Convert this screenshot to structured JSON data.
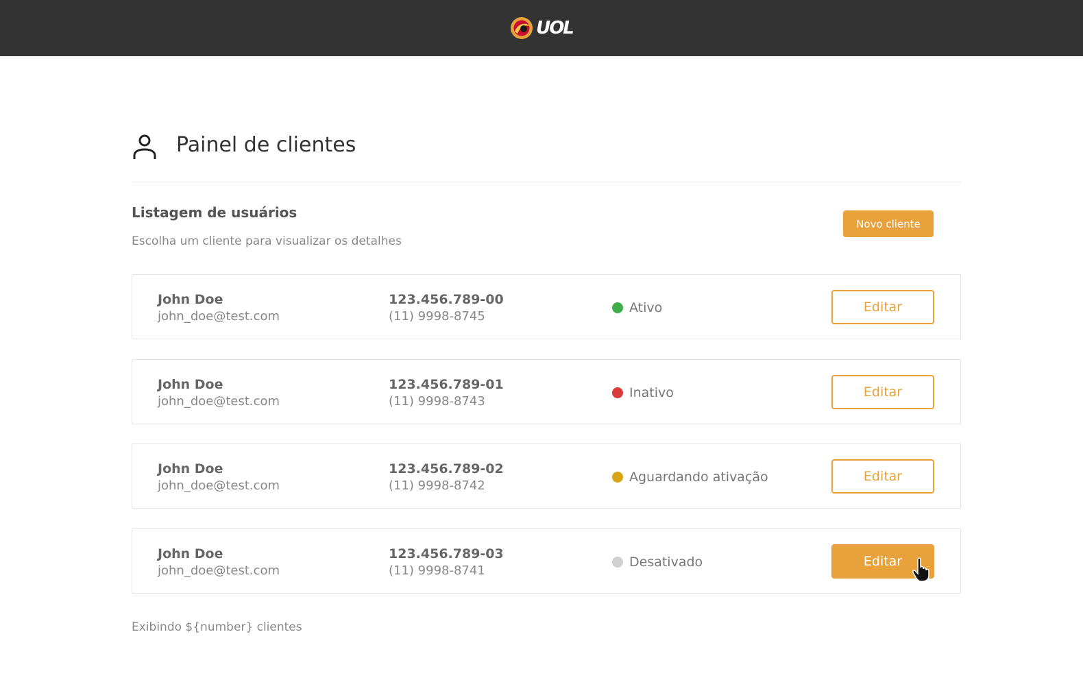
{
  "header": {
    "logo_text": "UOL",
    "logo_color": "#e8a23b",
    "background": "#333333"
  },
  "page": {
    "title": "Painel de clientes",
    "icon": "user-icon"
  },
  "listing": {
    "title": "Listagem de usuários",
    "subtitle": "Escolha um cliente para visualizar os detalhes",
    "new_button_label": "Novo cliente",
    "footer": "Exibindo ${number} clientes"
  },
  "clients": [
    {
      "name": "John Doe",
      "email": "john_doe@test.com",
      "document": "123.456.789-00",
      "phone": "(11) 9998-8745",
      "status": "Ativo",
      "status_color": "#3fae49",
      "edit_label": "Editar"
    },
    {
      "name": "John Doe",
      "email": "john_doe@test.com",
      "document": "123.456.789-01",
      "phone": "(11) 9998-8743",
      "status": "Inativo",
      "status_color": "#d93a3a",
      "edit_label": "Editar"
    },
    {
      "name": "John Doe",
      "email": "john_doe@test.com",
      "document": "123.456.789-02",
      "phone": "(11) 9998-8742",
      "status": "Aguardando ativação",
      "status_color": "#d8a514",
      "edit_label": "Editar"
    },
    {
      "name": "John Doe",
      "email": "john_doe@test.com",
      "document": "123.456.789-03",
      "phone": "(11) 9998-8741",
      "status": "Desativado",
      "status_color": "#d0d0d0",
      "edit_label": "Editar"
    }
  ],
  "colors": {
    "accent": "#e8a23b"
  }
}
